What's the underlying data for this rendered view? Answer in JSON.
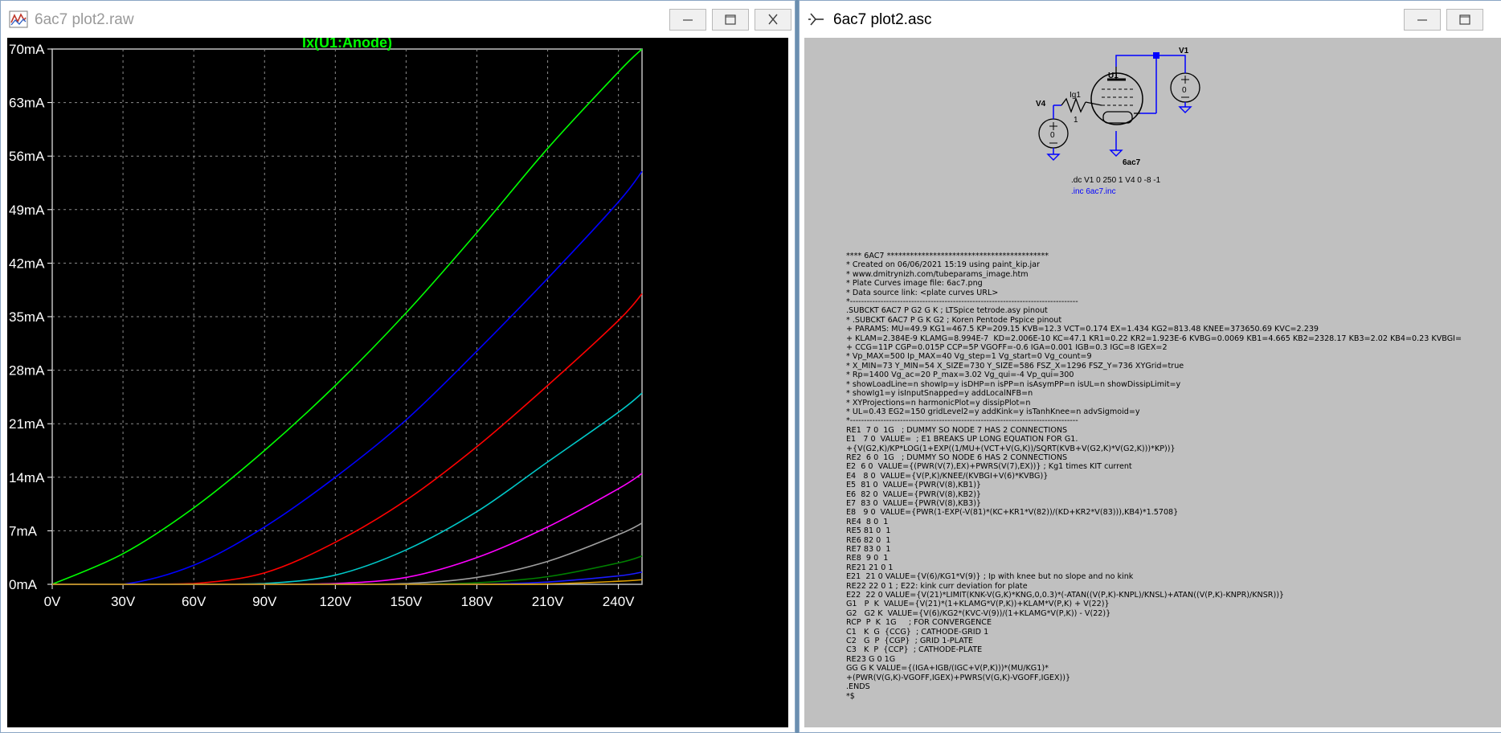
{
  "plot_window": {
    "title": "6ac7 plot2.raw",
    "icon": "waveform-icon",
    "controls": [
      "minimize-icon",
      "maximize-icon",
      "close-icon"
    ]
  },
  "schematic_window": {
    "title": "6ac7 plot2.asc",
    "icon": "schematic-icon",
    "controls": [
      "minimize-icon",
      "maximize-icon"
    ]
  },
  "colors": {
    "plot_background": "#000000",
    "grid": "#8c8c8c",
    "axis_text": "#ffffff",
    "trace_title": "#00ff00",
    "schematic_background": "#c0c0c0",
    "wire": "#0000ff"
  },
  "chart_data": {
    "type": "line",
    "title": "Ix(U1:Anode)",
    "xlabel": "",
    "ylabel": "",
    "xlim": [
      0,
      250
    ],
    "ylim": [
      0,
      70
    ],
    "x_ticks": [
      "0V",
      "30V",
      "60V",
      "90V",
      "120V",
      "150V",
      "180V",
      "210V",
      "240V"
    ],
    "y_ticks": [
      "0mA",
      "7mA",
      "14mA",
      "21mA",
      "28mA",
      "35mA",
      "42mA",
      "49mA",
      "56mA",
      "63mA",
      "70mA"
    ],
    "grid": true,
    "x": [
      0,
      30,
      60,
      90,
      120,
      150,
      180,
      210,
      240,
      250
    ],
    "series": [
      {
        "color": "#00ff00",
        "values": [
          0,
          4,
          10,
          17.5,
          26,
          35.5,
          46,
          57,
          67,
          70
        ]
      },
      {
        "color": "#0000ff",
        "values": [
          0,
          0,
          2.5,
          7.5,
          14,
          21.5,
          30.5,
          40,
          50,
          54
        ]
      },
      {
        "color": "#ff0000",
        "values": [
          0,
          0,
          0.1,
          1.5,
          5.5,
          11,
          18,
          26,
          34.5,
          38
        ]
      },
      {
        "color": "#00c8c8",
        "values": [
          0,
          0,
          0,
          0.1,
          1.2,
          4.5,
          9.5,
          16,
          22.5,
          25
        ]
      },
      {
        "color": "#ff00ff",
        "values": [
          0,
          0,
          0,
          0,
          0.1,
          0.9,
          3.5,
          7.5,
          12.5,
          14.5
        ]
      },
      {
        "color": "#a0a0a0",
        "values": [
          0,
          0,
          0,
          0,
          0,
          0.1,
          0.9,
          3,
          6.5,
          8
        ]
      },
      {
        "color": "#008000",
        "values": [
          0,
          0,
          0,
          0,
          0,
          0,
          0.2,
          1,
          2.8,
          3.7
        ]
      },
      {
        "color": "#1a1aff",
        "values": [
          0,
          0,
          0,
          0,
          0,
          0,
          0,
          0.3,
          1.1,
          1.6
        ]
      },
      {
        "color": "#e0a000",
        "values": [
          0,
          0,
          0,
          0,
          0,
          0,
          0,
          0.05,
          0.4,
          0.6
        ]
      }
    ]
  },
  "schematic": {
    "labels": {
      "v1": "V1",
      "v4": "V4",
      "u1": "U1",
      "ig1": "Ig1",
      "part": "6ac7",
      "v1_value": "0",
      "v4_value": "0",
      "ig1_value": "1",
      "dc_directive": ".dc V1 0 250 1 V4 0 -8 -1",
      "inc_directive": ".inc 6ac7.inc"
    },
    "netlist": [
      "**** 6AC7 ******************************************",
      "* Created on 06/06/2021 15:19 using paint_kip.jar",
      "* www.dmitrynizh.com/tubeparams_image.htm",
      "* Plate Curves image file: 6ac7.png",
      "* Data source link: <plate curves URL>",
      "*----------------------------------------------------------------------------------",
      ".SUBCKT 6AC7 P G2 G K ; LTSpice tetrode.asy pinout",
      "* .SUBCKT 6AC7 P G K G2 ; Koren Pentode Pspice pinout",
      "+ PARAMS: MU=49.9 KG1=467.5 KP=209.15 KVB=12.3 VCT=0.174 EX=1.434 KG2=813.48 KNEE=373650.69 KVC=2.239",
      "+ KLAM=2.384E-9 KLAMG=8.994E-7  KD=2.006E-10 KC=47.1 KR1=0.22 KR2=1.923E-6 KVBG=0.0069 KB1=4.665 KB2=2328.17 KB3=2.02 KB4=0.23 KVBGI=",
      "+ CCG=11P CGP=0.015P CCP=5P VGOFF=-0.6 IGA=0.001 IGB=0.3 IGC=8 IGEX=2",
      "* Vp_MAX=500 Ip_MAX=40 Vg_step=1 Vg_start=0 Vg_count=9",
      "* X_MIN=73 Y_MIN=54 X_SIZE=730 Y_SIZE=586 FSZ_X=1296 FSZ_Y=736 XYGrid=true",
      "* Rp=1400 Vg_ac=20 P_max=3.02 Vg_qui=-4 Vp_qui=300",
      "* showLoadLine=n showIp=y isDHP=n isPP=n isAsymPP=n isUL=n showDissipLimit=y",
      "* showIg1=y isInputSnapped=y addLocalNFB=n",
      "* XYProjections=n harmonicPlot=y dissipPlot=n",
      "* UL=0.43 EG2=150 gridLevel2=y addKink=y isTanhKnee=n advSigmoid=y",
      "*----------------------------------------------------------------------------------",
      "RE1  7 0  1G   ; DUMMY SO NODE 7 HAS 2 CONNECTIONS",
      "E1   7 0  VALUE=  ; E1 BREAKS UP LONG EQUATION FOR G1.",
      "+{V(G2,K)/KP*LOG(1+EXP((1/MU+(VCT+V(G,K))/SQRT(KVB+V(G2,K)*V(G2,K)))*KP))}",
      "RE2  6 0  1G   ; DUMMY SO NODE 6 HAS 2 CONNECTIONS",
      "E2  6 0  VALUE={(PWR(V(7),EX)+PWRS(V(7),EX))} ; Kg1 times KIT current",
      "E4   8 0  VALUE={V(P,K)/KNEE/(KVBGI+V(6)*KVBG)}",
      "E5  81 0  VALUE={PWR(V(8),KB1)}",
      "E6  82 0  VALUE={PWR(V(8),KB2)}",
      "E7  83 0  VALUE={PWR(V(8),KB3)}",
      "E8   9 0  VALUE={PWR(1-EXP(-V(81)*(KC+KR1*V(82))/(KD+KR2*V(83))),KB4)*1.5708}",
      "RE4  8 0  1",
      "RE5 81 0  1",
      "RE6 82 0  1",
      "RE7 83 0  1",
      "RE8  9 0  1",
      "RE21 21 0 1",
      "E21  21 0 VALUE={V(6)/KG1*V(9)} ; Ip with knee but no slope and no kink",
      "RE22 22 0 1 ; E22: kink curr deviation for plate",
      "E22  22 0 VALUE={V(21)*LIMIT(KNK-V(G,K)*KNG,0,0.3)*(-ATAN((V(P,K)-KNPL)/KNSL)+ATAN((V(P,K)-KNPR)/KNSR))}",
      "G1   P  K  VALUE={V(21)*(1+KLAMG*V(P,K))+KLAM*V(P,K) + V(22)}",
      "G2   G2 K  VALUE={V(6)/KG2*(KVC-V(9))/(1+KLAMG*V(P,K)) - V(22)}",
      "RCP  P  K  1G     ; FOR CONVERGENCE",
      "C1   K  G  {CCG}  ; CATHODE-GRID 1",
      "C2   G  P  {CGP}  ; GRID 1-PLATE",
      "C3   K  P  {CCP}  ; CATHODE-PLATE",
      "RE23 G 0 1G",
      "GG G K VALUE={(IGA+IGB/(IGC+V(P,K)))*(MU/KG1)*",
      "+(PWR(V(G,K)-VGOFF,IGEX)+PWRS(V(G,K)-VGOFF,IGEX))}",
      ".ENDS",
      "*$"
    ]
  }
}
